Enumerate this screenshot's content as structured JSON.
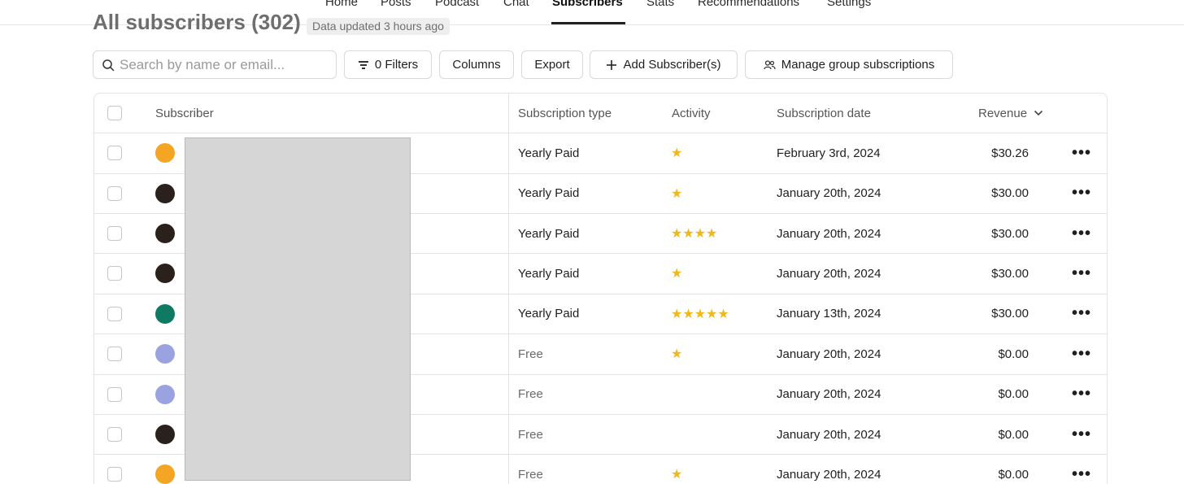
{
  "nav": {
    "items": [
      "Home",
      "Posts",
      "Podcast",
      "Chat",
      "Subscribers",
      "Stats",
      "Recommendations",
      "Settings"
    ],
    "active": "Subscribers"
  },
  "page": {
    "title": "All subscribers (302)",
    "updated": "Data updated 3 hours ago"
  },
  "toolbar": {
    "search_placeholder": "Search by name or email...",
    "filters": "0 Filters",
    "columns": "Columns",
    "export": "Export",
    "add": "Add Subscriber(s)",
    "manage": "Manage group subscriptions"
  },
  "table": {
    "headers": {
      "subscriber": "Subscriber",
      "type": "Subscription type",
      "activity": "Activity",
      "date": "Subscription date",
      "revenue": "Revenue"
    },
    "rows": [
      {
        "type": "Yearly Paid",
        "stars": "★",
        "date": "February 3rd, 2024",
        "revenue": "$30.26",
        "avatar": "#f5a524",
        "free": false
      },
      {
        "type": "Yearly Paid",
        "stars": "★",
        "date": "January 20th, 2024",
        "revenue": "$30.00",
        "avatar": "#2b211c",
        "free": false
      },
      {
        "type": "Yearly Paid",
        "stars": "★★★★",
        "date": "January 20th, 2024",
        "revenue": "$30.00",
        "avatar": "#2b211c",
        "free": false
      },
      {
        "type": "Yearly Paid",
        "stars": "★",
        "date": "January 20th, 2024",
        "revenue": "$30.00",
        "avatar": "#2b211c",
        "free": false
      },
      {
        "type": "Yearly Paid",
        "stars": "★★★★★",
        "date": "January 13th, 2024",
        "revenue": "$30.00",
        "avatar": "#0f7a63",
        "free": false
      },
      {
        "type": "Free",
        "stars": "★",
        "date": "January 20th, 2024",
        "revenue": "$0.00",
        "avatar": "#9aa3df",
        "free": true
      },
      {
        "type": "Free",
        "stars": "",
        "date": "January 20th, 2024",
        "revenue": "$0.00",
        "avatar": "#9aa3df",
        "free": true
      },
      {
        "type": "Free",
        "stars": "",
        "date": "January 20th, 2024",
        "revenue": "$0.00",
        "avatar": "#2b211c",
        "free": true
      },
      {
        "type": "Free",
        "stars": "★",
        "date": "January 20th, 2024",
        "revenue": "$0.00",
        "avatar": "#f5a524",
        "free": true
      }
    ]
  },
  "colors": {
    "star": "#f1b81c",
    "border": "#e3e3e3",
    "redaction": "#d6d6d6"
  },
  "icons": [
    "search-icon",
    "filter-icon",
    "plus-icon",
    "users-icon",
    "chevron-down-icon",
    "more-icon"
  ]
}
